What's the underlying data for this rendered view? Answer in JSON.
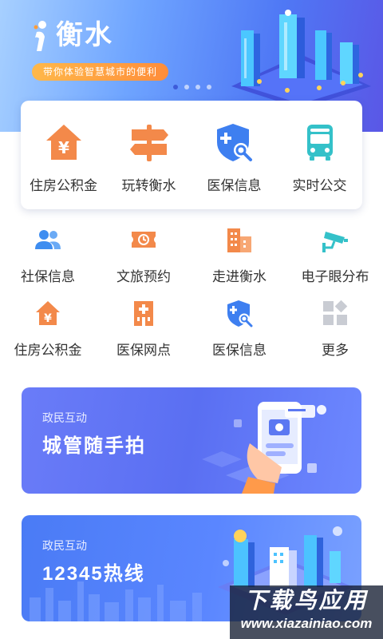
{
  "hero": {
    "title": "衡水",
    "slogan": "带你体验智慧城市的便利",
    "carousel_total": 4,
    "carousel_active": 1
  },
  "primary_services": [
    {
      "label": "住房公积金",
      "icon": "house-yuan-icon"
    },
    {
      "label": "玩转衡水",
      "icon": "signpost-icon"
    },
    {
      "label": "医保信息",
      "icon": "shield-search-icon"
    },
    {
      "label": "实时公交",
      "icon": "bus-icon"
    }
  ],
  "secondary_services": [
    [
      {
        "label": "社保信息",
        "icon": "people-icon"
      },
      {
        "label": "文旅预约",
        "icon": "ticket-clock-icon"
      },
      {
        "label": "走进衡水",
        "icon": "buildings-icon"
      },
      {
        "label": "电子眼分布",
        "icon": "cctv-camera-icon"
      }
    ],
    [
      {
        "label": "住房公积金",
        "icon": "house-yuan-icon"
      },
      {
        "label": "医保网点",
        "icon": "hospital-icon"
      },
      {
        "label": "医保信息",
        "icon": "shield-search-icon"
      },
      {
        "label": "更多",
        "icon": "more-grid-icon"
      }
    ]
  ],
  "promos": [
    {
      "tag": "政民互动",
      "title": "城管随手拍",
      "icon": "phone-camera-illustration"
    },
    {
      "tag": "政民互动",
      "title": "12345热线",
      "icon": "city-hotline-illustration"
    }
  ],
  "watermark": {
    "line1": "下载鸟应用",
    "line2": "www.xiazainiao.com"
  },
  "colors": {
    "orange": "#f3894a",
    "blue": "#3e7ff0",
    "teal": "#34c1c9",
    "gray": "#c9ccd3"
  }
}
